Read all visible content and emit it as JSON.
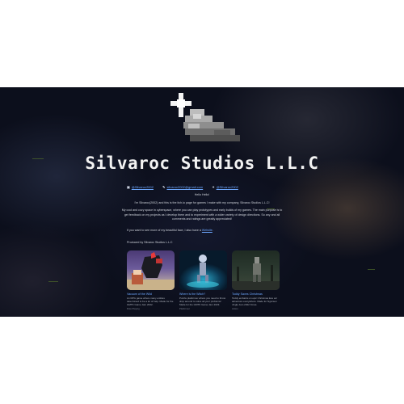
{
  "site": {
    "title": "Silvaroc Studios L.L.C",
    "links": [
      {
        "icon": "mastodon-icon",
        "glyph": "▣",
        "label": "@Silvaroc2002"
      },
      {
        "icon": "pen-icon",
        "glyph": "✎",
        "label": "silvaroc2002@gmail.com"
      },
      {
        "icon": "twitter-icon",
        "glyph": "✦",
        "label": "@Silvaroc2002"
      }
    ],
    "greeting": "Hello Hello!",
    "intro_1": "I'm Silvaroc(2002) and this is the itch.io page for games I make with my company, Silvaroc Studios L.L.C!",
    "intro_2": "My cool and cozy space in cyberspace, where you can play prototypes and early builds of my games. The main purpose is to get feedback on my projects as I develop them and to experiment with a wider variety of design directions. So any and all comments and ratings are greatly appreciated!",
    "more_prefix": "If you want to see more of my beautiful face, I also have a",
    "more_link": "Website",
    "more_suffix": "."
  },
  "games_section": {
    "label": "Produced by Silvaroc Studios L.L.C",
    "games": [
      {
        "title": "Vacuum of the Wild",
        "desc": "An RPG game where many entities determined to be a lot of help. Made for the GMTK Game Jam 2022.",
        "meta": "Role Playing"
      },
      {
        "title": "Where is the Witch?",
        "desc": "Puzzle platformer where you need to throw drop around to solve all your problems! Made for the GMTK Game Jam 2023.",
        "meta": "Platformer"
      },
      {
        "title": "Toddy Saves Christmas",
        "desc": "Toddy embarks on epic Christmas Eve ad adventure everywhere. Made for Ngccsen Jingle Jam 2022 Xmas.",
        "meta": "Action"
      }
    ]
  }
}
